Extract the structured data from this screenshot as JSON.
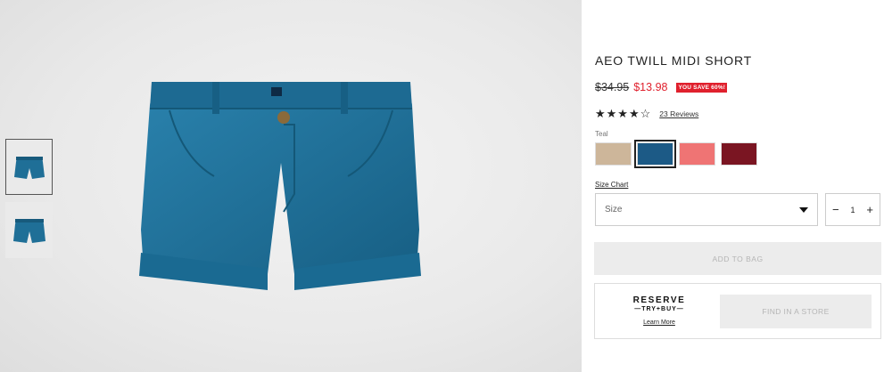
{
  "product": {
    "title": "AEO TWILL MIDI SHORT",
    "price_old": "$34.95",
    "price_new": "$13.98",
    "save_badge": "YOU SAVE 60%!",
    "rating_stars": "★★★★☆",
    "rating_value": 4.5,
    "reviews_label": "23 Reviews",
    "selected_color_name": "Teal",
    "swatches": [
      {
        "name": "Khaki",
        "color": "#cdb69a",
        "selected": false
      },
      {
        "name": "Teal",
        "color": "#1c5a86",
        "selected": true
      },
      {
        "name": "Coral",
        "color": "#ef7474",
        "selected": false
      },
      {
        "name": "Burgundy",
        "color": "#7a1522",
        "selected": false
      }
    ],
    "size_chart_label": "Size Chart",
    "size_placeholder": "Size",
    "quantity": "1",
    "qty_minus": "−",
    "qty_plus": "+",
    "add_to_bag_label": "ADD TO BAG",
    "reserve_word": "RESERVE",
    "reserve_sub": "—TRY+BUY—",
    "learn_more": "Learn More",
    "find_store_label": "FIND IN A STORE"
  },
  "colors": {
    "sale_red": "#e0202d",
    "shorts_teal": "#1f6f97",
    "disabled_grey": "#ececec"
  },
  "icons": {
    "dropdown": "caret-down-icon",
    "rating": "star-icon"
  }
}
